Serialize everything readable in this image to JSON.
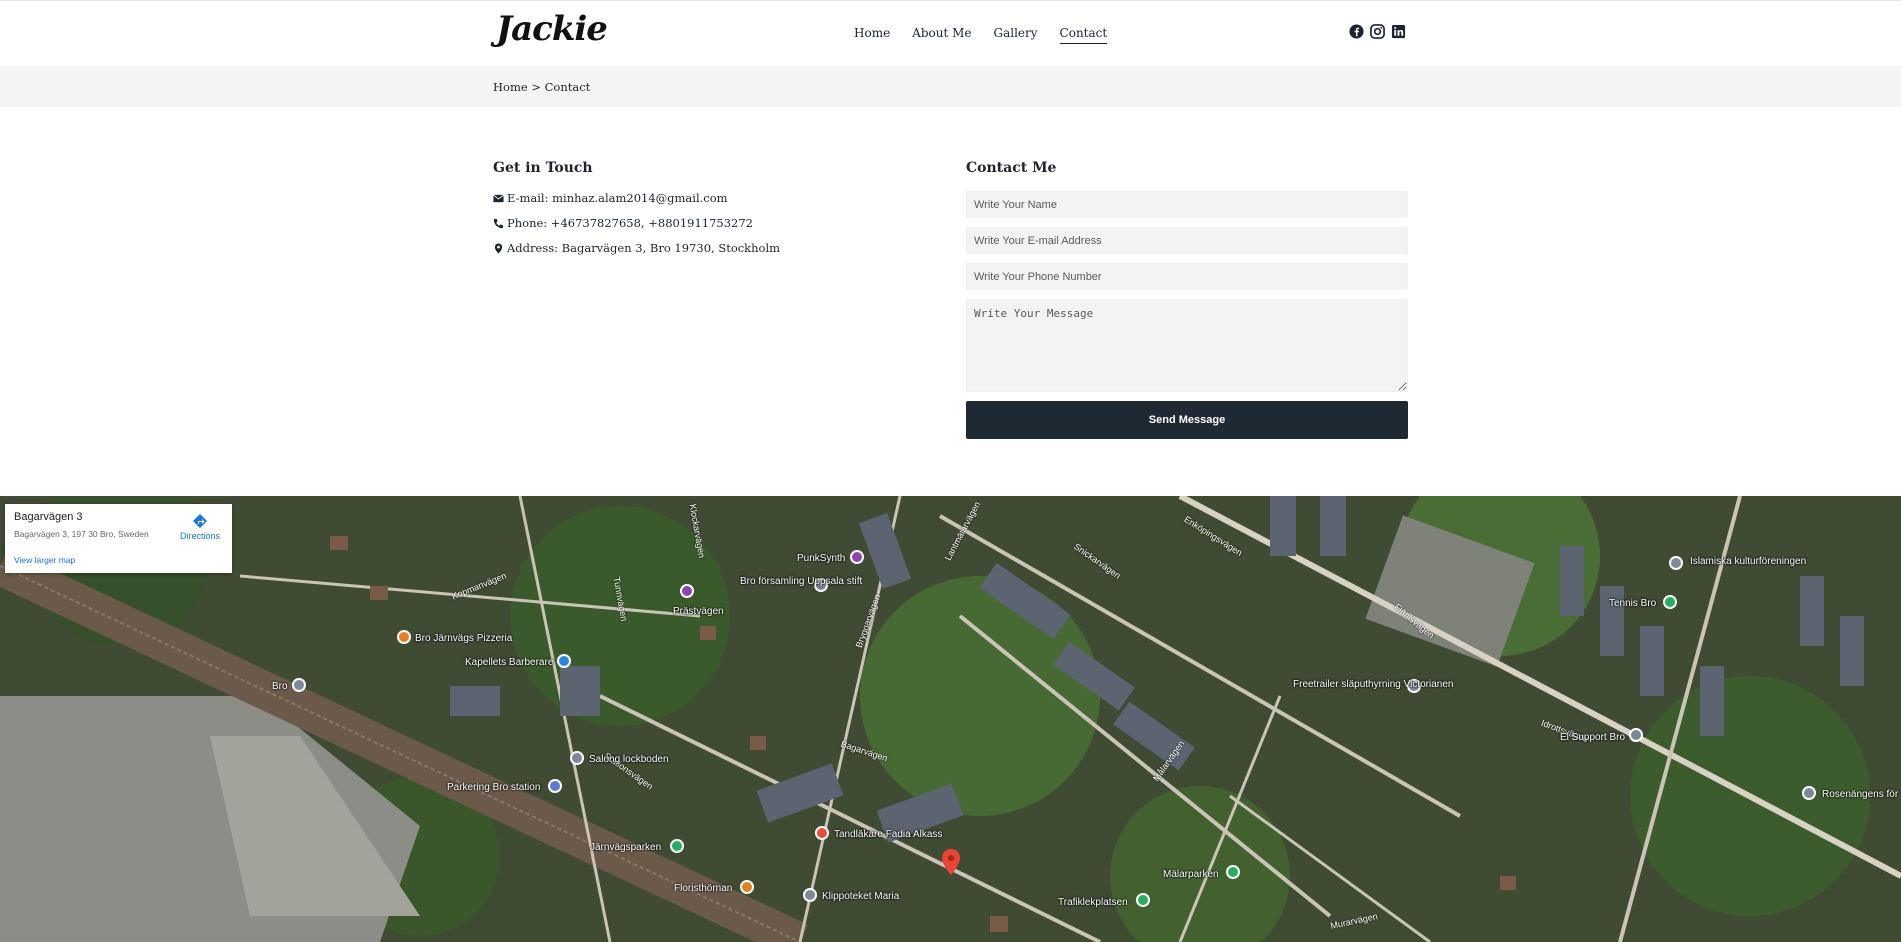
{
  "header": {
    "logo": "Jackie",
    "nav": [
      {
        "label": "Home",
        "active": false
      },
      {
        "label": "About Me",
        "active": false
      },
      {
        "label": "Gallery",
        "active": false
      },
      {
        "label": "Contact",
        "active": true
      }
    ],
    "social_icons": [
      "facebook-icon",
      "instagram-icon",
      "linkedin-icon"
    ]
  },
  "breadcrumb": {
    "text": "Home > Contact"
  },
  "touch": {
    "title": "Get in Touch",
    "email": "E-mail: minhaz.alam2014@gmail.com",
    "phone": "Phone: +46737827658, +8801911753272",
    "address": "Address: Bagarvägen 3, Bro 19730, Stockholm"
  },
  "form": {
    "title": "Contact Me",
    "name_placeholder": "Write Your Name",
    "email_placeholder": "Write Your E-mail Address",
    "phone_placeholder": "Write Your Phone Number",
    "message_placeholder": "Write Your Message",
    "submit_label": "Send Message"
  },
  "map": {
    "card_title": "Bagarvägen 3",
    "card_address": "Bagarvägen 3, 197 30 Bro, Sweden",
    "directions_label": "Directions",
    "larger_map_label": "View larger map",
    "places": [
      "PunkSynth",
      "Bro församling Uppsala stift",
      "Prästvägen",
      "Bro Järnvägs Pizzeria",
      "Kapellets Barberare",
      "Bro",
      "Salong lockboden",
      "Parkering Bro station",
      "Järnvägsparken",
      "Floristhörnan",
      "Klippoteket Maria",
      "Tandläkare Fadia Alkass",
      "Mälarparken",
      "Trafiklekplatsen",
      "Freetrailer släputhyrning Victorianen",
      "El Support Bro",
      "Tennis Bro",
      "Islamiska kulturföreningen",
      "Rosenängens för"
    ],
    "roads": [
      "Lantmätarvägen",
      "Snickarvägen",
      "Enköpingsvägen",
      "Bagarvägen",
      "Stationsvägen",
      "Kopmanvägen",
      "Tunnvägen",
      "Bryggarvägen",
      "Målarvägen",
      "Murarvägen",
      "Klockarvägen",
      "Idrottsvägen",
      "Fjärilsvägen"
    ]
  }
}
